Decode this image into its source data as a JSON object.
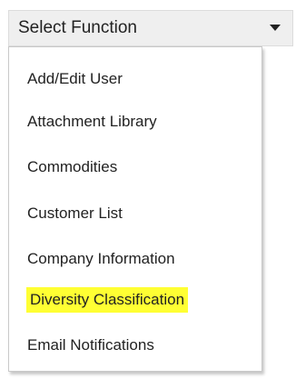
{
  "select": {
    "label": "Select Function",
    "caret_icon": "caret-down-icon"
  },
  "menu": {
    "items": [
      {
        "label": "Add/Edit User"
      },
      {
        "label": "Attachment Library"
      },
      {
        "label": "Commodities"
      },
      {
        "label": "Customer List"
      },
      {
        "label": "Company Information"
      },
      {
        "label": "Diversity Classification",
        "highlighted": true
      },
      {
        "label": "Email Notifications"
      }
    ],
    "highlight_color": "#ffff33"
  }
}
